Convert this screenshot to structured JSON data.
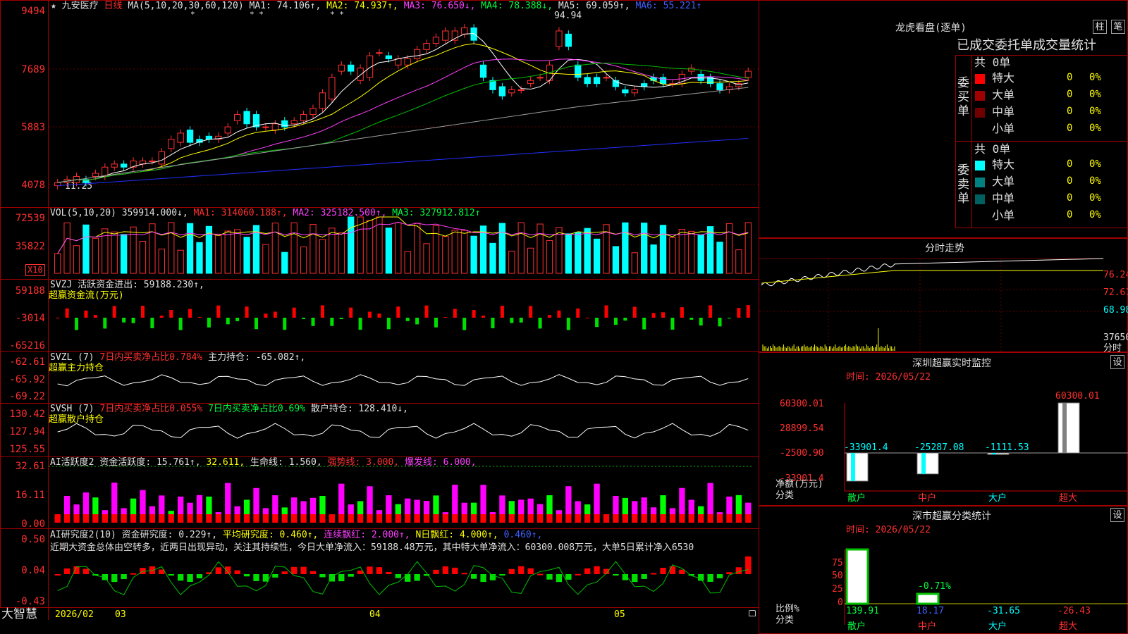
{
  "app": {
    "brand": "大智慧"
  },
  "kline": {
    "star": "★",
    "name": "九安医疗",
    "period": "日线",
    "ma_head": "MA(5,10,20,30,60,120)",
    "ma1": "MA1: 74.106↑,",
    "ma2": "MA2: 74.937↑,",
    "ma3": "MA3: 76.650↓,",
    "ma4": "MA4: 78.388↓,",
    "ma5": "MA5: 69.059↑,",
    "ma6": "MA6: 55.221↑",
    "axis": [
      "9494",
      "7689",
      "5883",
      "4078"
    ],
    "high_label": "94.94",
    "low_label": "11.25",
    "stars": [
      "*",
      "* *",
      "* *"
    ]
  },
  "vol": {
    "head": "VOL(5,10,20)",
    "v": "359914.000↓,",
    "ma1": "MA1: 314060.188↑,",
    "ma2": "MA2: 325182.500↑,",
    "ma3": "MA3: 327912.812↑",
    "axis": [
      "72539",
      "35822"
    ],
    "unit": "X10"
  },
  "svzj": {
    "head": "SVZJ  活跃资金进出: 59188.230↑,",
    "sub": "超赢资金流(万元)",
    "axis": [
      "59188",
      "-3014",
      "-65216"
    ]
  },
  "svzl": {
    "head_a": "SVZL (7)",
    "head_b": "7日内买卖净占比0.784%",
    "head_c": "主力持仓: -65.082↑,",
    "sub": "超赢主力持仓",
    "axis": [
      "-62.61",
      "-65.92",
      "-69.22"
    ]
  },
  "svsh": {
    "head_a": "SVSH (7)",
    "head_b": "7日内买卖净占比0.055%",
    "head_c": "7日内买卖净占比0.69%",
    "head_d": "散户持仓: 128.410↓,",
    "sub": "超赢散户持仓",
    "axis": [
      "130.42",
      "127.94",
      "125.55"
    ]
  },
  "ai1": {
    "head_a": "AI活跃度2",
    "head_b": "资金活跃度: 15.761↑,",
    "head_c": "32.611,",
    "head_d": "生命线: 1.560,",
    "head_e": "强势线: 3.000,",
    "head_f": "爆发线: 6.000,",
    "axis": [
      "32.61",
      "16.11",
      "0.00"
    ]
  },
  "ai2": {
    "head_a": "AI研究度2(10)",
    "head_b": "资金研究度: 0.229↑,",
    "head_c": "平均研究度: 0.460↑,",
    "head_d": "连续飘红: 2.000↑,",
    "head_e": "N日飘红: 4.000↑,",
    "head_f": "0.460↑,",
    "comment": "近期大资金总体由空转多，近两日出现异动，关注其持续性，今日大单净流入：59188.48万元，其中特大单净流入：60300.008万元，大单5日累计净入6530",
    "axis": [
      "0.50",
      "0.04",
      "-0.43"
    ]
  },
  "date_axis": [
    "2026/02",
    "03",
    "04",
    "05"
  ],
  "lhb": {
    "title": "龙虎看盘(逐单)",
    "btn_col": "柱",
    "btn_pen": "笔",
    "subtitle": "已成交委托单成交量统计",
    "buy": {
      "side": "委买单",
      "total": "共 0单",
      "rows": [
        {
          "name": "特大",
          "val": "0",
          "pct": "0%",
          "color": "#ff0000"
        },
        {
          "name": "大单",
          "val": "0",
          "pct": "0%",
          "color": "#a00000"
        },
        {
          "name": "中单",
          "val": "0",
          "pct": "0%",
          "color": "#700000"
        },
        {
          "name": "小单",
          "val": "0",
          "pct": "0%",
          "color": "#000000"
        }
      ]
    },
    "sell": {
      "side": "委卖单",
      "total": "共 0单",
      "rows": [
        {
          "name": "特大",
          "val": "0",
          "pct": "0%",
          "color": "#00ffff"
        },
        {
          "name": "大单",
          "val": "0",
          "pct": "0%",
          "color": "#008080"
        },
        {
          "name": "中单",
          "val": "0",
          "pct": "0%",
          "color": "#006060"
        },
        {
          "name": "小单",
          "val": "0",
          "pct": "0%",
          "color": "#000000"
        }
      ]
    }
  },
  "intraday": {
    "title": "分时走势",
    "axis": [
      "76.24",
      "72.61",
      "68.98",
      "37650"
    ],
    "unit": "分时"
  },
  "monitor": {
    "title": "深圳超赢实时监控",
    "btn": "设",
    "time": "时间: 2026/05/22",
    "axis": [
      "60300.01",
      "28899.54",
      "-2500.90",
      "-33901.4"
    ],
    "unit_a": "净额(万元)",
    "unit_b": "分类",
    "categories": [
      "散户",
      "中户",
      "大户",
      "超大"
    ],
    "values": [
      -33901.4,
      -25287.08,
      -1111.53,
      60300.01
    ],
    "value_labels": [
      "-33901.4",
      "-25287.08",
      "-1111.53",
      "60300.01"
    ]
  },
  "classify": {
    "title": "深市超赢分类统计",
    "btn": "设",
    "time": "时间: 2026/05/22",
    "axis": [
      "75",
      "50",
      "25",
      "0"
    ],
    "unit_a": "比例%",
    "unit_b": "分类",
    "categories": [
      "散户",
      "中户",
      "大户",
      "超大"
    ],
    "values": [
      139.91,
      18.17,
      -31.65,
      -26.43
    ],
    "value_labels": [
      "139.91",
      "18.17",
      "-31.65",
      "-26.43"
    ],
    "small_label": "-0.71%"
  },
  "colors": {
    "up": "#ff3030",
    "down": "#00ffff",
    "frame": "#a00000",
    "ma1": "#ffffff",
    "ma2": "#ffff00",
    "ma3": "#ff40ff",
    "ma4": "#00c000",
    "ma5": "#a0a0a0",
    "ma6": "#2030ff"
  },
  "chart_data": {
    "type": "candlestick",
    "title": "九安医疗 日线",
    "candles_open": [
      41,
      42,
      42,
      43,
      44,
      44,
      47,
      48,
      47,
      48,
      49,
      48,
      53,
      55,
      59,
      56,
      57,
      56,
      58,
      62,
      65,
      64,
      60,
      59,
      62,
      61,
      62,
      64,
      66,
      69,
      78,
      80,
      75,
      76,
      84,
      83,
      80,
      80,
      82,
      85,
      87,
      88,
      88,
      90,
      92,
      80,
      75,
      73,
      71,
      72,
      74,
      76,
      75,
      86,
      90,
      80,
      76,
      76,
      76,
      75,
      72,
      71,
      74,
      76,
      76,
      74,
      74,
      78,
      77,
      76,
      74,
      72,
      73,
      76
    ],
    "candles_close": [
      42,
      43,
      44,
      42,
      45,
      47,
      48,
      47,
      49,
      49,
      49,
      52,
      56,
      58,
      55,
      55,
      56,
      57,
      60,
      64,
      61,
      60,
      60,
      61,
      60,
      62,
      64,
      66,
      71,
      76,
      80,
      78,
      79,
      83,
      84,
      82,
      82,
      82,
      85,
      87,
      89,
      91,
      91,
      92,
      88,
      76,
      72,
      70,
      72,
      72,
      75,
      76,
      80,
      91,
      86,
      76,
      74,
      74,
      76,
      73,
      71,
      72,
      73,
      75,
      74,
      74,
      77,
      79,
      75,
      74,
      72,
      73,
      74,
      78
    ],
    "ylim": [
      40,
      96
    ]
  }
}
